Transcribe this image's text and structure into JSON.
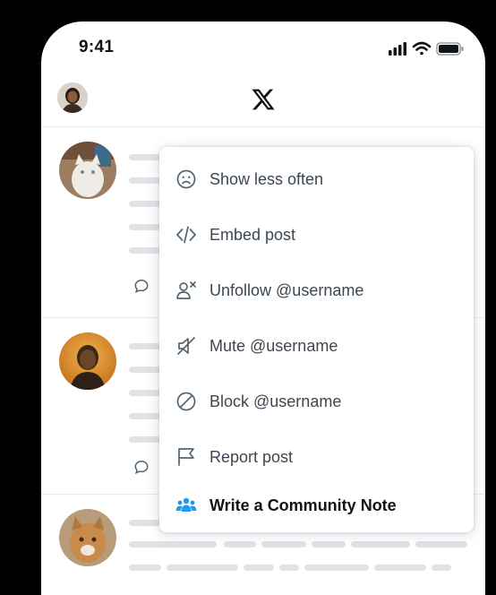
{
  "status_bar": {
    "time": "9:41"
  },
  "header": {
    "logo": "x-logo",
    "avatar": "profile-avatar"
  },
  "menu": {
    "items": [
      {
        "label": "Show less often",
        "icon": "frown-face-icon"
      },
      {
        "label": "Embed post",
        "icon": "code-icon"
      },
      {
        "label": "Unfollow @username",
        "icon": "unfollow-user-icon"
      },
      {
        "label": "Mute @username",
        "icon": "mute-speaker-icon"
      },
      {
        "label": "Block @username",
        "icon": "block-icon"
      },
      {
        "label": "Report post",
        "icon": "flag-icon"
      },
      {
        "label": "Write a Community Note",
        "icon": "community-people-icon"
      }
    ]
  },
  "colors": {
    "background": "#000000",
    "surface": "#ffffff",
    "text_primary": "#0f1419",
    "text_menu": "#3d4752",
    "placeholder": "#dfe3e6",
    "community_icon": "#1d9bf0",
    "divider": "#e7e9ea"
  }
}
